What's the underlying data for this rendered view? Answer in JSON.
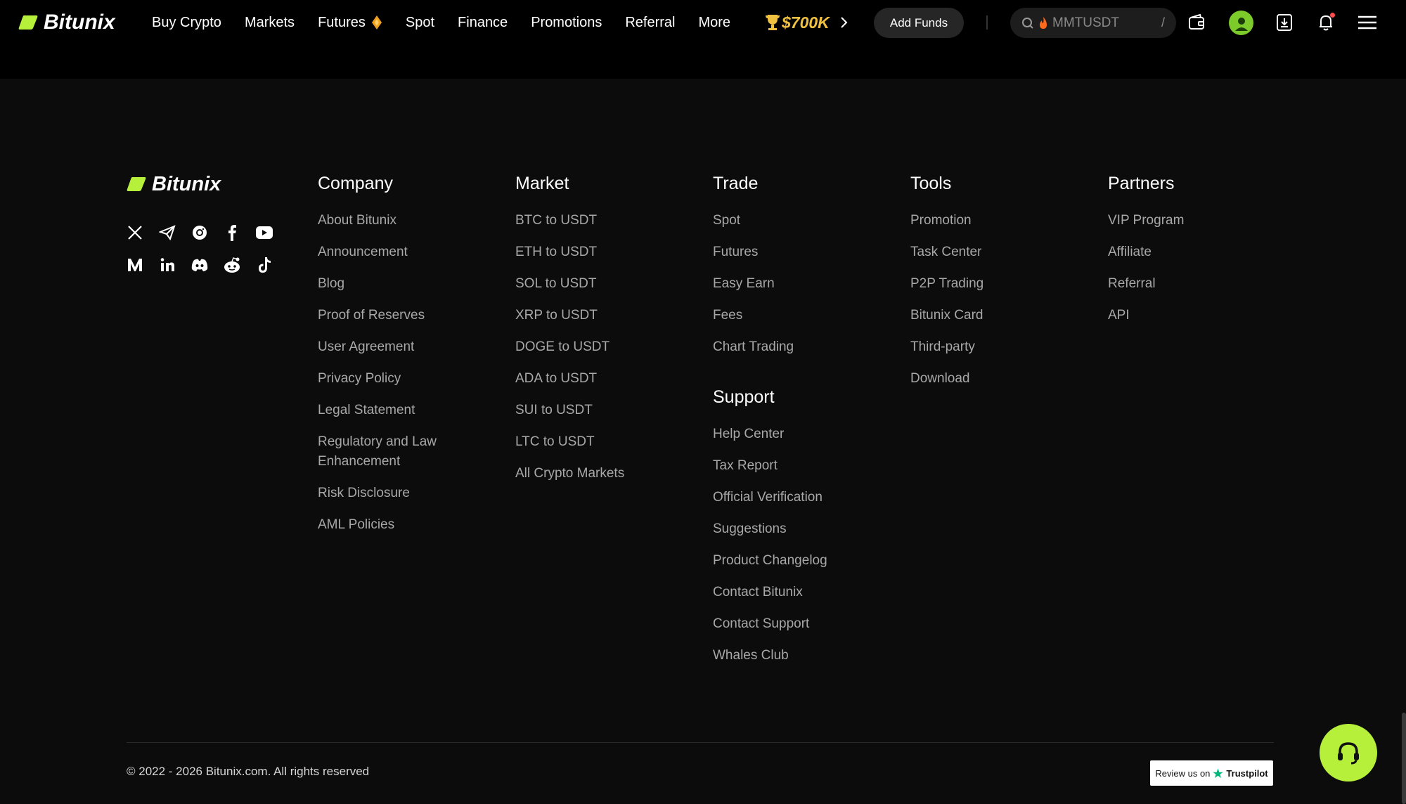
{
  "brand": {
    "name": "Bitunix",
    "accent": "#b6f03a"
  },
  "header": {
    "nav": [
      "Buy Crypto",
      "Markets",
      "Futures",
      "Spot",
      "Finance",
      "Promotions",
      "Referral",
      "More"
    ],
    "promo_badge": "$700K",
    "add_funds": "Add Funds",
    "search_text": "MMTUSDT",
    "search_shortcut": "/",
    "icons": [
      "wallet-icon",
      "avatar",
      "download-icon",
      "bell-icon",
      "menu-icon"
    ]
  },
  "footer": {
    "social": [
      "x-icon",
      "telegram-icon",
      "instagram-icon",
      "facebook-icon",
      "youtube-icon",
      "medium-icon",
      "linkedin-icon",
      "discord-icon",
      "reddit-icon",
      "tiktok-icon"
    ],
    "columns": {
      "company": {
        "title": "Company",
        "links": [
          "About Bitunix",
          "Announcement",
          "Blog",
          "Proof of Reserves",
          "User Agreement",
          "Privacy Policy",
          "Legal Statement",
          "Regulatory and Law Enhancement",
          "Risk Disclosure",
          "AML Policies"
        ]
      },
      "market": {
        "title": "Market",
        "links": [
          "BTC to USDT",
          "ETH to USDT",
          "SOL to USDT",
          "XRP to USDT",
          "DOGE to USDT",
          "ADA to USDT",
          "SUI to USDT",
          "LTC to USDT",
          "All Crypto Markets"
        ]
      },
      "trade": {
        "title": "Trade",
        "links": [
          "Spot",
          "Futures",
          "Easy Earn",
          "Fees",
          "Chart Trading"
        ]
      },
      "support": {
        "title": "Support",
        "links": [
          "Help Center",
          "Tax Report",
          "Official Verification",
          "Suggestions",
          "Product Changelog",
          "Contact Bitunix",
          "Contact Support",
          "Whales Club"
        ]
      },
      "tools": {
        "title": "Tools",
        "links": [
          "Promotion",
          "Task Center",
          "P2P Trading",
          "Bitunix Card",
          "Third-party",
          "Download"
        ]
      },
      "partners": {
        "title": "Partners",
        "links": [
          "VIP Program",
          "Affiliate",
          "Referral",
          "API"
        ]
      }
    },
    "copyright": "© 2022 - 2026 Bitunix.com. All rights reserved",
    "trustpilot": {
      "prefix": "Review us on",
      "brand": "Trustpilot"
    }
  }
}
